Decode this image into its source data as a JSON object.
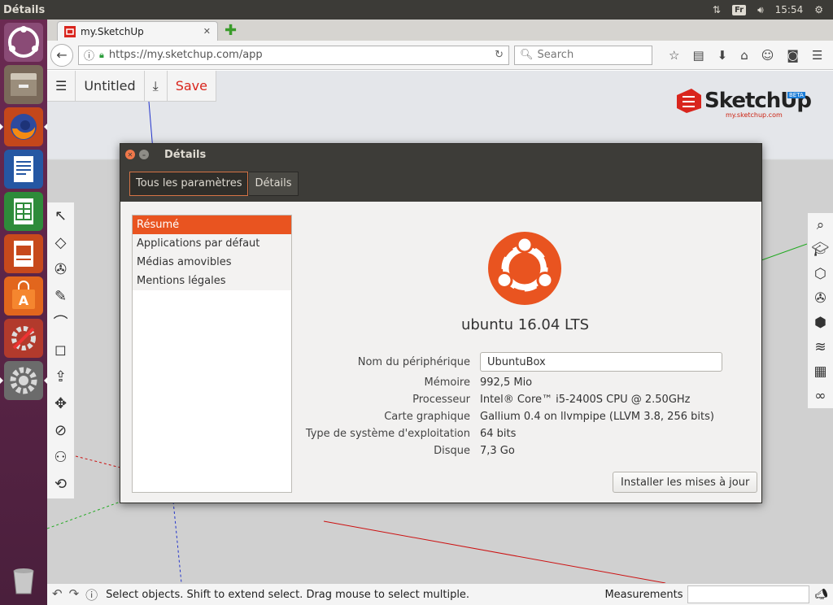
{
  "top_panel": {
    "title": "Détails",
    "keyboard_layout": "Fr",
    "clock": "15:54"
  },
  "browser": {
    "tab_title": "my.SketchUp",
    "url": "https://my.sketchup.com/app",
    "search_placeholder": "Search"
  },
  "sketchup": {
    "document_title": "Untitled",
    "save_label": "Save",
    "logo_text": "SketchUp",
    "logo_beta": "BETA",
    "logo_sub": "my.sketchup.com",
    "status_message": "Select objects. Shift to extend select. Drag mouse to select multiple.",
    "measurements_label": "Measurements"
  },
  "dialog": {
    "title": "Détails",
    "toolbar": {
      "all_settings": "Tous les paramètres",
      "details": "Détails"
    },
    "sidebar": [
      {
        "label": "Résumé",
        "selected": true
      },
      {
        "label": "Applications par défaut",
        "selected": false
      },
      {
        "label": "Médias amovibles",
        "selected": false
      },
      {
        "label": "Mentions légales",
        "selected": false
      }
    ],
    "distro": "ubuntu 16.04 LTS",
    "device_name_label": "Nom du périphérique",
    "device_name_value": "UbuntuBox",
    "info": [
      {
        "key": "Mémoire",
        "value": "992,5 Mio"
      },
      {
        "key": "Processeur",
        "value": "Intel® Core™ i5-2400S CPU @ 2.50GHz"
      },
      {
        "key": "Carte graphique",
        "value": "Gallium 0.4 on llvmpipe (LLVM 3.8, 256 bits)"
      },
      {
        "key": "Type de système d'exploitation",
        "value": "64 bits"
      },
      {
        "key": "Disque",
        "value": "7,3 Go"
      }
    ],
    "update_button": "Installer les mises à jour"
  },
  "colors": {
    "ubuntu_orange": "#e95420",
    "panel_dark": "#3c3b37",
    "sketchup_red": "#d9251d"
  }
}
